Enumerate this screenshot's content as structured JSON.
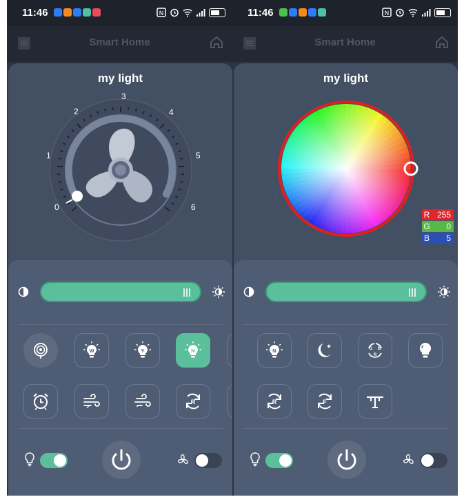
{
  "status_bar": {
    "time": "11:46"
  },
  "app_bar": {
    "title": "Smart Home"
  },
  "left_screen": {
    "device_name": "my light",
    "fan_dial": {
      "speed_labels": [
        "0",
        "1",
        "2",
        "3",
        "4",
        "5",
        "6"
      ],
      "current_speed": 0
    },
    "brightness_fraction": 1.0,
    "light_toggle": "on",
    "fan_toggle": "off"
  },
  "right_screen": {
    "device_name": "my light",
    "rgb": {
      "r_label": "R",
      "r_value": "255",
      "g_label": "G",
      "g_value": "0",
      "b_label": "B",
      "b_value": "5"
    },
    "brightness_fraction": 1.0,
    "light_toggle": "on",
    "fan_toggle": "off"
  },
  "mode_letters": {
    "w": "W",
    "y": "Y",
    "n": "N",
    "r": "R",
    "f": "F",
    "b": "B"
  },
  "icons": [
    "menu-icon",
    "home-icon",
    "contrast-icon",
    "sun-icon",
    "bulb-icon",
    "fan-icon",
    "power-icon",
    "alarm-icon",
    "wind-icon",
    "moon-icon",
    "cycle-icon"
  ],
  "colors": {
    "accent": "#5bbf9c",
    "panel": "#435064",
    "bottom_panel": "#4f5d74",
    "ring_red": "#e02020",
    "r_bg": "#e0262b",
    "g_bg": "#54b948",
    "b_bg": "#2b4fb5"
  }
}
